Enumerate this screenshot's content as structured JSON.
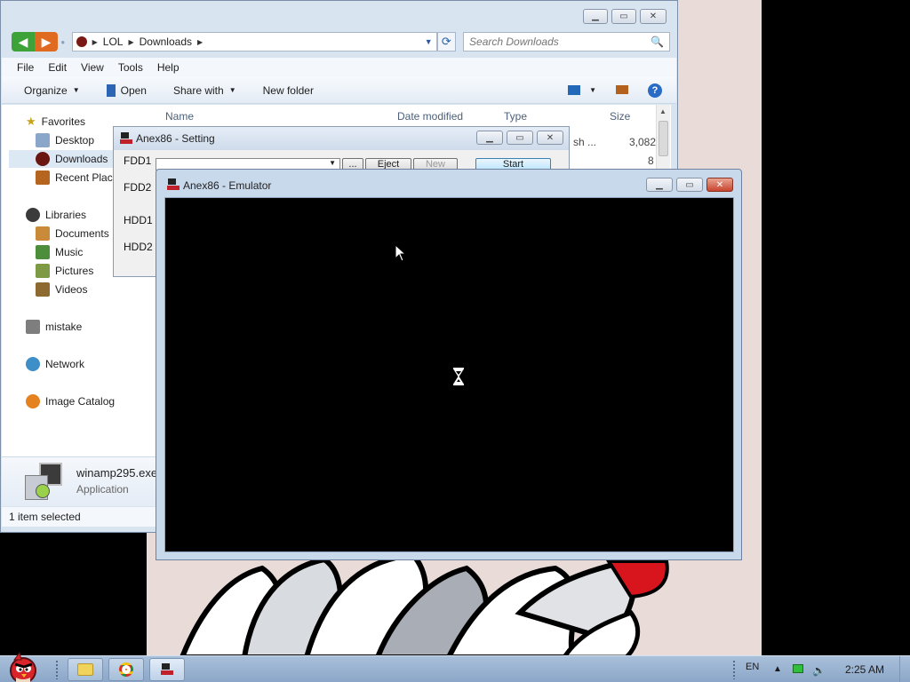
{
  "explorer": {
    "breadcrumb": [
      "LOL",
      "Downloads"
    ],
    "search_placeholder": "Search Downloads",
    "menu": [
      "File",
      "Edit",
      "View",
      "Tools",
      "Help"
    ],
    "toolbar": {
      "organize": "Organize",
      "open": "Open",
      "share_with": "Share with",
      "new_folder": "New folder"
    },
    "nav": {
      "favorites": "Favorites",
      "desktop": "Desktop",
      "downloads": "Downloads",
      "recent_places": "Recent Place",
      "libraries": "Libraries",
      "documents": "Documents",
      "music": "Music",
      "pictures": "Pictures",
      "videos": "Videos",
      "mistake": "mistake",
      "network": "Network",
      "image_catalog": "Image Catalog"
    },
    "columns": {
      "name": "Name",
      "date_modified": "Date modified",
      "type": "Type",
      "size": "Size"
    },
    "row_fragments": {
      "type1": "sh ...",
      "size1": "3,082",
      "size2": "8"
    },
    "details": {
      "filename": "winamp295.exe",
      "filetype": "Application"
    },
    "status": "1 item selected"
  },
  "setting": {
    "title": "Anex86 - Setting",
    "drives": [
      "FDD1",
      "FDD2",
      "HDD1",
      "HDD2"
    ],
    "browse": "...",
    "eject": "Eject",
    "new": "New",
    "start": "Start"
  },
  "emulator": {
    "title": "Anex86 - Emulator"
  },
  "taskbar": {
    "language": "EN",
    "time": "2:25 AM"
  },
  "icons": {
    "back": "back-arrow-icon",
    "forward": "forward-arrow-icon",
    "refresh": "refresh-icon",
    "search": "magnifier-icon",
    "help": "help-icon",
    "window_app": "anex86-icon"
  },
  "colors": {
    "explorer_frame": "#d9e4f1",
    "emulator_screen": "#000000",
    "start_button": "#bee6fd",
    "taskbar": "#a9c0da"
  }
}
